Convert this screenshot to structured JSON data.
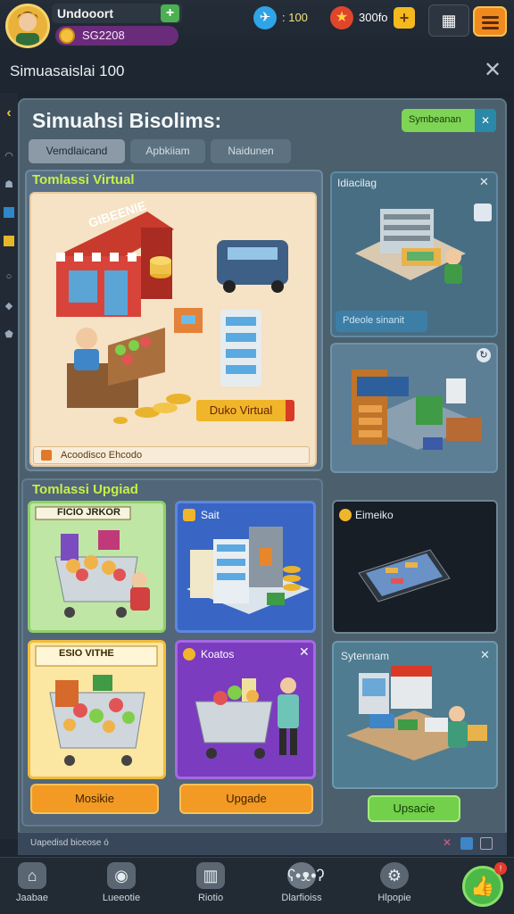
{
  "header": {
    "player_name": "Undooort",
    "coins": "SG2208",
    "plane_value": ": 100",
    "star_value": "300fo",
    "plus_label": "+"
  },
  "title_row": {
    "title": "Simuasaislai 100",
    "close": "✕"
  },
  "dialog": {
    "title": "Simuahsi Bisolims:",
    "system_button": "Symbeanan",
    "system_close": "✕",
    "tabs": [
      "Vemdlaicand",
      "Apbkiiam",
      "Naidunen"
    ]
  },
  "section_virtual": {
    "title": "Tomlassi Virtual",
    "store_sign": "GIBEENIE",
    "badge": "Duko Virtual",
    "footer": "Acoodisco Ehcodo"
  },
  "right_cards": {
    "top": {
      "title": "Idiacilag",
      "button": "Pdeole sinanit"
    },
    "middle": {
      "title": ""
    }
  },
  "section_upgrade": {
    "title": "Tomlassi Upgiad",
    "cards": [
      {
        "title": "FICIO JRKOR"
      },
      {
        "title": "Sait"
      },
      {
        "title": "ESIO VITHE"
      },
      {
        "title": "Koatos"
      }
    ],
    "button_left": "Mosikie",
    "button_right": "Upgade"
  },
  "side_cards": {
    "dark": {
      "title": "Eimeiko"
    },
    "system": {
      "title": "Sytennam",
      "button": "Upsacie"
    }
  },
  "status_bar": {
    "text": "Uapedisd biceose ó"
  },
  "nav": [
    {
      "label": "Jaabae",
      "icon": "home-icon"
    },
    {
      "label": "Lueeotie",
      "icon": "location-icon"
    },
    {
      "label": "Riotio",
      "icon": "building-icon"
    },
    {
      "label": "Dlarfioiss",
      "icon": "bear-icon"
    },
    {
      "label": "Hlpopie",
      "icon": "gear-icon"
    },
    {
      "label": "",
      "icon": "thumb-icon"
    }
  ],
  "colors": {
    "accent_green": "#c7ef49",
    "orange": "#f29a24",
    "purple": "#7b3cbf",
    "blue": "#3965c4"
  }
}
